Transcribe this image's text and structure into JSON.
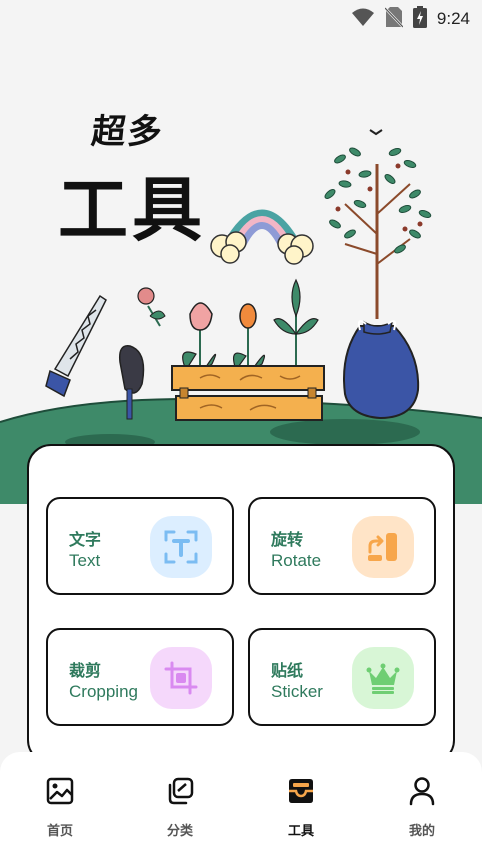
{
  "status_bar": {
    "time": "9:24",
    "icons": [
      "wifi-icon",
      "no-sim-icon",
      "battery-charging-icon"
    ]
  },
  "hero": {
    "title_small": "超多",
    "title_big": "工具"
  },
  "tools": [
    {
      "name_zh": "文字",
      "name_en": "Text",
      "icon": "text-scan-icon",
      "color": "#dceeff",
      "accent": "#7bbcf2"
    },
    {
      "name_zh": "旋转",
      "name_en": "Rotate",
      "icon": "rotate-icon",
      "color": "#ffe4c7",
      "accent": "#f7a64b"
    },
    {
      "name_zh": "裁剪",
      "name_en": "Cropping",
      "icon": "crop-icon",
      "color": "#f5d8fb",
      "accent": "#d98af0"
    },
    {
      "name_zh": "贴纸",
      "name_en": "Sticker",
      "icon": "crown-icon",
      "color": "#d8f6d6",
      "accent": "#6fce73"
    }
  ],
  "nav": {
    "active": "工具",
    "items": [
      {
        "label": "首页",
        "icon": "image-icon"
      },
      {
        "label": "分类",
        "icon": "category-icon"
      },
      {
        "label": "工具",
        "icon": "toolbox-icon"
      },
      {
        "label": "我的",
        "icon": "user-icon"
      }
    ]
  },
  "colors": {
    "brand_green": "#2f7a5d",
    "hill_green": "#3e8a69"
  }
}
